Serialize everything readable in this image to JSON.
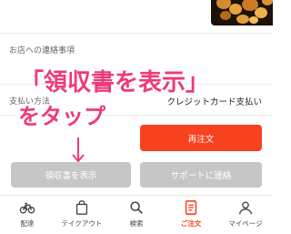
{
  "order_details": {
    "contact_label": "お店への連絡事項",
    "payment_label": "支払い方法",
    "payment_value": "クレジットカード支払い"
  },
  "annotation": {
    "line1": "「領収書を表示」",
    "line2": "をタップ",
    "color": "#ee3a7a"
  },
  "buttons": {
    "reorder": "再注文",
    "receipt": "領収書を表示",
    "support": "サポートに連絡"
  },
  "tabbar": {
    "items": [
      {
        "label": "配達",
        "icon": "bicycle-icon"
      },
      {
        "label": "テイクアウト",
        "icon": "shopping-bag-icon"
      },
      {
        "label": "検索",
        "icon": "search-icon"
      },
      {
        "label": "ご注文",
        "icon": "receipt-icon",
        "active": true
      },
      {
        "label": "マイページ",
        "icon": "user-icon"
      }
    ],
    "active_color": "#f8411f"
  },
  "colors": {
    "primary_button": "#f8411f",
    "disabled_button": "#c6c6c6"
  }
}
